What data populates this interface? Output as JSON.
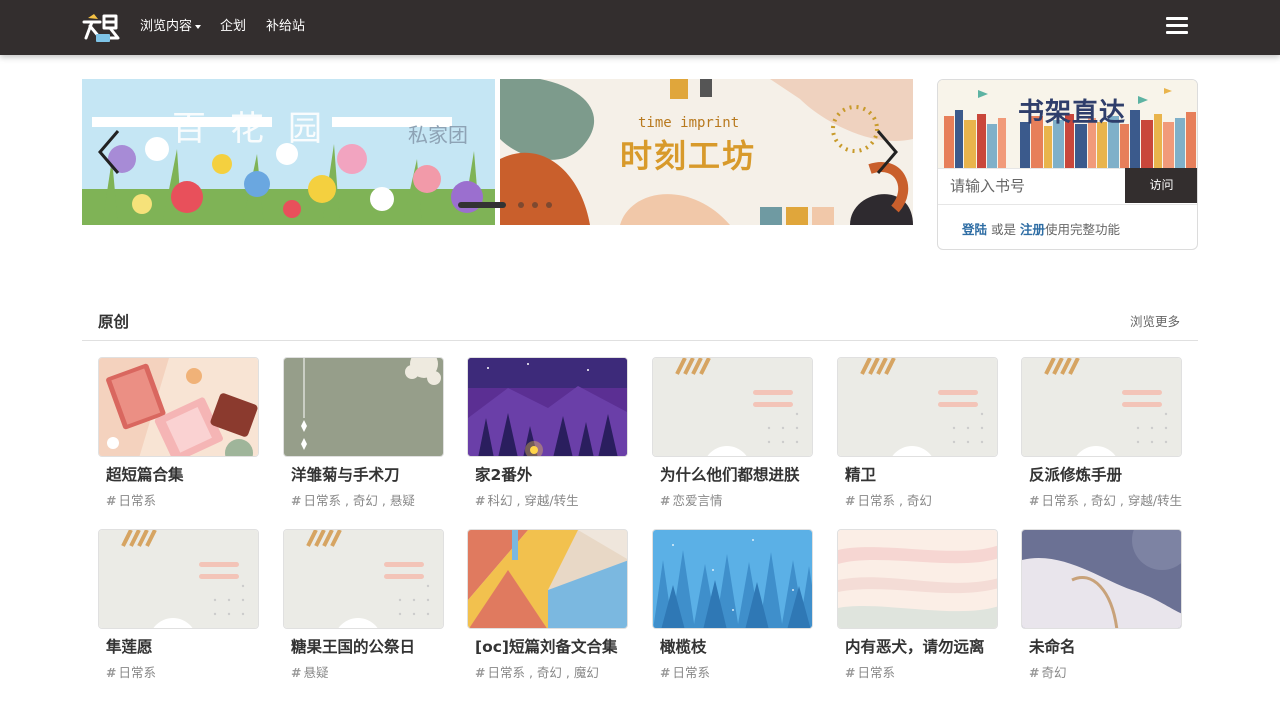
{
  "nav": {
    "logo_text": "文鸟",
    "links": [
      {
        "label": "浏览内容",
        "has_dropdown": true
      },
      {
        "label": "企划",
        "has_dropdown": false
      },
      {
        "label": "补给站",
        "has_dropdown": false
      }
    ],
    "menu_icon": "hamburger-icon",
    "background": "#332e2e"
  },
  "carousel": {
    "slides": [
      {
        "title": "百花园",
        "badge": "私家团"
      },
      {
        "title": "时刻工坊",
        "subtitle": "time imprint"
      }
    ],
    "prev_icon": "chevron-left-icon",
    "next_icon": "chevron-right-icon",
    "indicator_count": 4,
    "active_index": 0
  },
  "shelf": {
    "banner_title": "书架直达",
    "input_placeholder": "请输入书号",
    "button_label": "访问",
    "login_label": "登陆",
    "or_label": "或是",
    "register_label": "注册",
    "suffix_label": "使用完整功能",
    "accent": "#2e6da4"
  },
  "section": {
    "title": "原创",
    "more_label": "浏览更多"
  },
  "books": [
    {
      "title": "超短篇合集",
      "tags": "日常系",
      "cover": "books"
    },
    {
      "title": "洋雏菊与手术刀",
      "tags": "日常系 , 奇幻 , 悬疑",
      "cover": "sage"
    },
    {
      "title": "家2番外",
      "tags": "科幻 , 穿越/转生",
      "cover": "night"
    },
    {
      "title": "为什么他们都想进朕",
      "tags": "恋爱言情",
      "cover": "default"
    },
    {
      "title": "精卫",
      "tags": "日常系 , 奇幻",
      "cover": "default"
    },
    {
      "title": "反派修炼手册",
      "tags": "日常系 , 奇幻 , 穿越/转生",
      "cover": "default"
    },
    {
      "title": "隼莲愿",
      "tags": "日常系",
      "cover": "default"
    },
    {
      "title": "糖果王国的公祭日",
      "tags": "悬疑",
      "cover": "default"
    },
    {
      "title": "[oc]短篇刘备文合集",
      "tags": "日常系 , 奇幻 , 魔幻",
      "cover": "geometric"
    },
    {
      "title": "橄榄枝",
      "tags": "日常系",
      "cover": "forest"
    },
    {
      "title": "内有恶犬，请勿远离",
      "tags": "日常系",
      "cover": "stripes"
    },
    {
      "title": "未命名",
      "tags": "奇幻",
      "cover": "wave"
    }
  ]
}
